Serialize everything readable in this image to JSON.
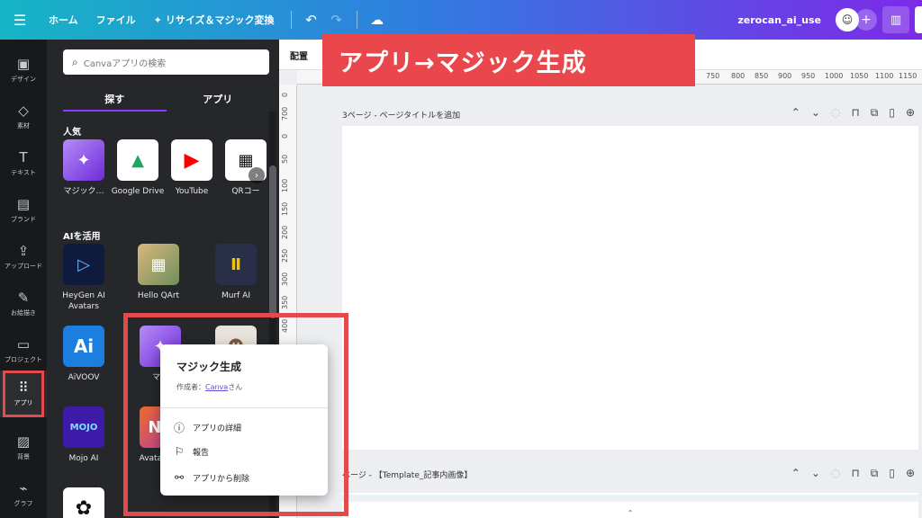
{
  "topbar": {
    "home": "ホーム",
    "file": "ファイル",
    "resize": "リサイズ＆マジック変換",
    "project_name": "zerocan_ai_use"
  },
  "rail": {
    "items": [
      {
        "label": "デザイン",
        "icon": "layout-icon"
      },
      {
        "label": "素材",
        "icon": "shapes-icon"
      },
      {
        "label": "テキスト",
        "icon": "text-icon"
      },
      {
        "label": "ブランド",
        "icon": "brand-icon"
      },
      {
        "label": "アップロード",
        "icon": "upload-icon"
      },
      {
        "label": "お絵描き",
        "icon": "draw-icon"
      },
      {
        "label": "プロジェクト",
        "icon": "folder-icon"
      },
      {
        "label": "アプリ",
        "icon": "apps-icon"
      },
      {
        "label": "背景",
        "icon": "background-icon"
      },
      {
        "label": "グラフ",
        "icon": "chart-icon"
      }
    ]
  },
  "panel": {
    "search_placeholder": "Canvaアプリの検索",
    "tabs": [
      "探す",
      "アプリ"
    ],
    "popular_title": "人気",
    "popular": [
      "マジック…",
      "Google Drive",
      "YouTube",
      "QRコー"
    ],
    "ai_title": "AIを活用",
    "ai_apps": [
      "HeyGen AI Avatars",
      "Hello QArt",
      "Murf AI",
      "AiVOOV",
      "マジ",
      "Mojo AI",
      "Avata Neir"
    ]
  },
  "editor": {
    "arrange": "配置",
    "ruler_ticks": [
      "750",
      "800",
      "850",
      "900",
      "950",
      "1000",
      "1050",
      "1100",
      "1150"
    ],
    "vruler_ticks": [
      "0",
      "700",
      "0",
      "50",
      "100",
      "150",
      "200",
      "250",
      "300",
      "350",
      "400"
    ],
    "page3_title": "3ページ - ページタイトルを追加",
    "page4_title": "ページ - 【Template_記事内画像】"
  },
  "banner": "アプリ→マジック生成",
  "popup": {
    "title": "マジック生成",
    "author_prefix": "作成者：",
    "author_link": "Canva",
    "author_suffix": "さん",
    "details": "アプリの詳細",
    "report": "報告",
    "remove": "アプリから削除"
  },
  "colors": {
    "accent": "#8b3dff",
    "highlight": "#e24b4b",
    "panel_bg": "#25272b"
  }
}
